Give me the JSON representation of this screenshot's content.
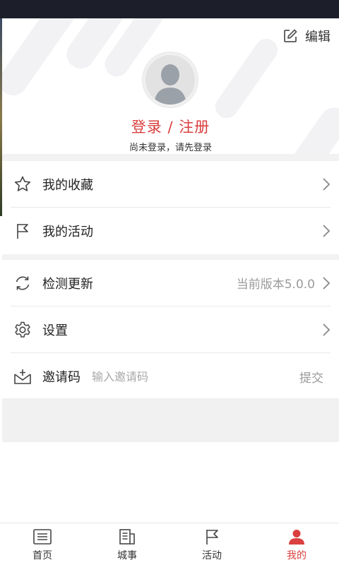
{
  "profile": {
    "edit_label": "编辑",
    "login_label": "登录 / 注册",
    "login_hint": "尚未登录，请先登录"
  },
  "menu": {
    "favorites": "我的收藏",
    "activities": "我的活动",
    "check_update": "检测更新",
    "version_text": "当前版本5.0.0",
    "settings": "设置",
    "invite_code": "邀请码",
    "invite_placeholder": "输入邀请码",
    "submit": "提交"
  },
  "tabs": {
    "home": "首页",
    "city": "城事",
    "activity": "活动",
    "mine": "我的"
  },
  "colors": {
    "accent": "#d9403f",
    "status_bar": "#1c1f2a"
  },
  "icons": [
    "edit-icon",
    "avatar-icon",
    "star-icon",
    "flag-icon",
    "chevron-right-icon",
    "refresh-icon",
    "gear-icon",
    "inbox-icon",
    "list-icon",
    "document-icon",
    "user-icon"
  ]
}
